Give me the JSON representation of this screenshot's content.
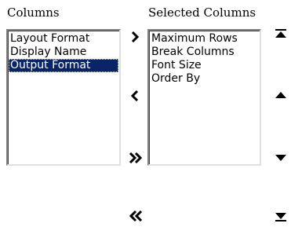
{
  "available": {
    "heading": "Columns",
    "items": [
      {
        "label": "Layout Format",
        "selected": false
      },
      {
        "label": "Display Name",
        "selected": false
      },
      {
        "label": "Output Format",
        "selected": true
      }
    ]
  },
  "selected": {
    "heading": "Selected Columns",
    "items": [
      {
        "label": "Maximum Rows"
      },
      {
        "label": "Break Columns"
      },
      {
        "label": "Font Size"
      },
      {
        "label": "Order By"
      }
    ]
  },
  "transfer_buttons": {
    "add": {
      "icon": "chevron-right-icon"
    },
    "remove": {
      "icon": "chevron-left-icon"
    },
    "add_all": {
      "icon": "double-chevron-right-icon"
    },
    "remove_all": {
      "icon": "double-chevron-left-icon"
    }
  },
  "order_buttons": {
    "move_top": {
      "icon": "move-to-top-icon"
    },
    "move_up": {
      "icon": "move-up-icon"
    },
    "move_down": {
      "icon": "move-down-icon"
    },
    "move_bottom": {
      "icon": "move-to-bottom-icon"
    }
  },
  "colors": {
    "selection_background": "#0a246a",
    "selection_text": "#ffffff"
  }
}
